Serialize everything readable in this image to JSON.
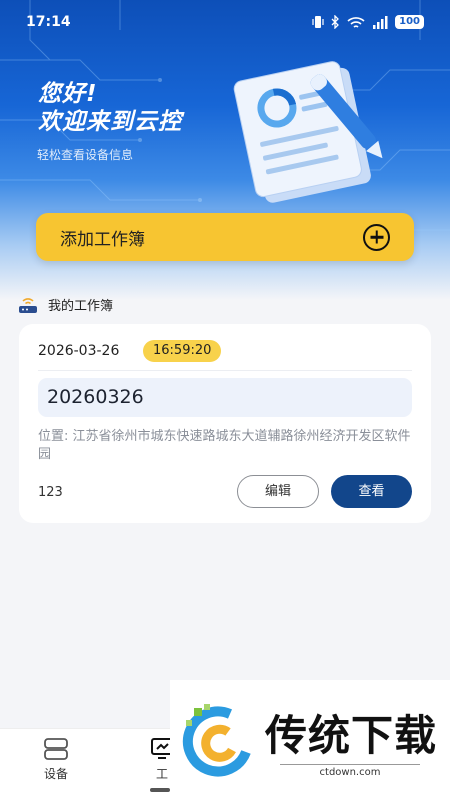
{
  "status_bar": {
    "time": "17:14",
    "battery": "100"
  },
  "hero": {
    "greeting_line1": "您好!",
    "greeting_line2": "欢迎来到云控",
    "subtitle": "轻松查看设备信息"
  },
  "add_button": {
    "label": "添加工作簿"
  },
  "section": {
    "title": "我的工作簿"
  },
  "workbook": {
    "date": "2026-03-26",
    "time": "16:59:20",
    "name": "20260326",
    "location": "位置: 江苏省徐州市城东快速路城东大道辅路徐州经济开发区软件园",
    "count": "123",
    "edit_label": "编辑",
    "view_label": "查看"
  },
  "bottom_nav": {
    "device_label": "设备",
    "workbook_label": "工"
  },
  "watermark": {
    "text": "传统下载",
    "url": "ctdown.com"
  },
  "colors": {
    "accent_yellow": "#f7c531",
    "primary_blue": "#12468b",
    "hero_blue": "#1766d6"
  }
}
